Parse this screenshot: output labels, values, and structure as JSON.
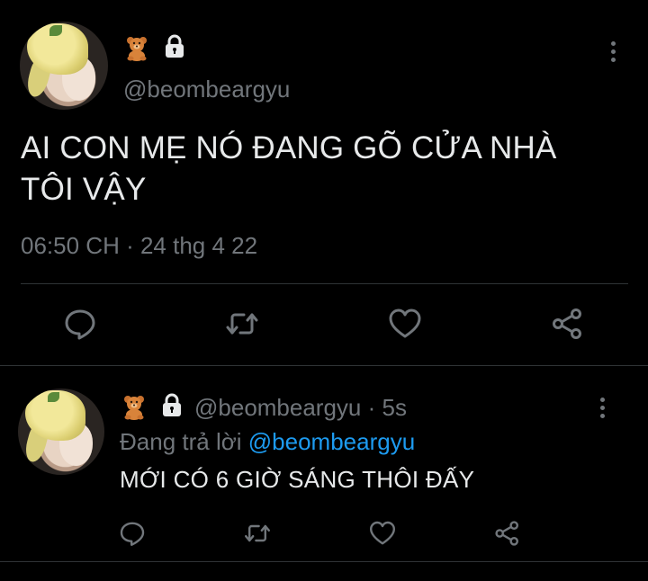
{
  "main_tweet": {
    "handle": "@beombeargyu",
    "badges": [
      "bear-emoji",
      "lock-emoji"
    ],
    "text_line1": "AI CON MẸ NÓ ĐANG GÕ CỬA NHÀ",
    "text_line2": "TÔI VẬY",
    "timestamp": "06:50 CH · 24 thg 4 22",
    "actions": [
      "reply-icon",
      "retweet-icon",
      "like-icon",
      "share-icon"
    ]
  },
  "reply_tweet": {
    "handle_time": "@beombeargyu · 5s",
    "replying_prefix": "Đang trả lời ",
    "replying_to": "@beombeargyu",
    "text": "MỚI CÓ 6 GIỜ SÁNG THÔI ĐẤY",
    "actions": [
      "reply-icon",
      "retweet-icon",
      "like-icon",
      "share-icon"
    ]
  },
  "colors": {
    "background": "#000000",
    "text": "#e7e9ea",
    "secondary": "#71767b",
    "link": "#1d9bf0",
    "divider": "#2f3336"
  }
}
